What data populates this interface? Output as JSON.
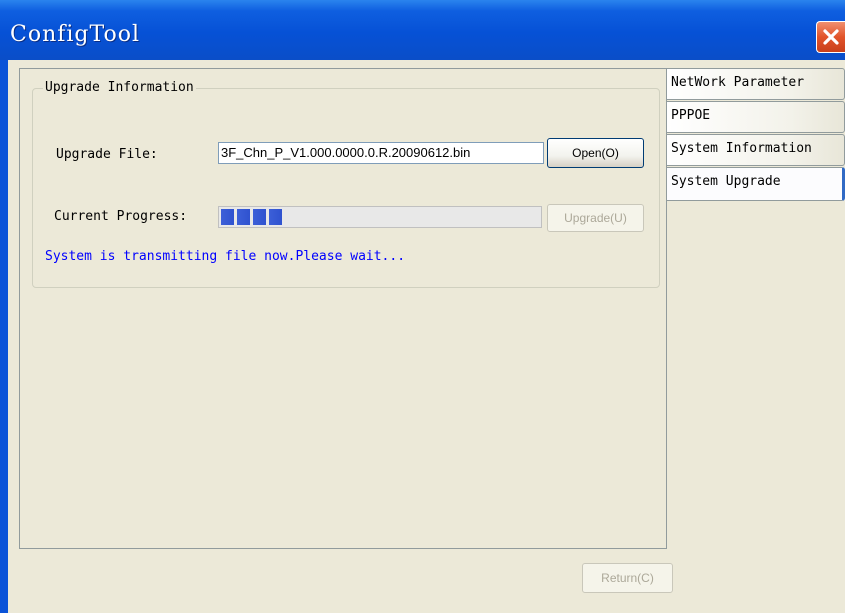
{
  "window": {
    "title": "ConfigTool"
  },
  "tabs": [
    {
      "label": "NetWork Parameter",
      "active": false
    },
    {
      "label": "PPPOE",
      "active": false
    },
    {
      "label": "System Information",
      "active": false
    },
    {
      "label": "System Upgrade",
      "active": true
    }
  ],
  "upgrade": {
    "group_title": "Upgrade Information",
    "file_label": "Upgrade File:",
    "file_value": "3F_Chn_P_V1.000.0000.0.R.20090612.bin",
    "open_label": "Open(O)",
    "progress_label": "Current Progress:",
    "progress_fraction": 0.2,
    "upgrade_label": "Upgrade(U)",
    "status_message": "System is transmitting file now.Please wait..."
  },
  "footer": {
    "return_label": "Return(C)"
  },
  "colors": {
    "title_bar": "#0a53d8",
    "status_text": "#0000ff",
    "progress": "#3c5fd8"
  },
  "icons": {
    "close": "close-x-icon"
  }
}
